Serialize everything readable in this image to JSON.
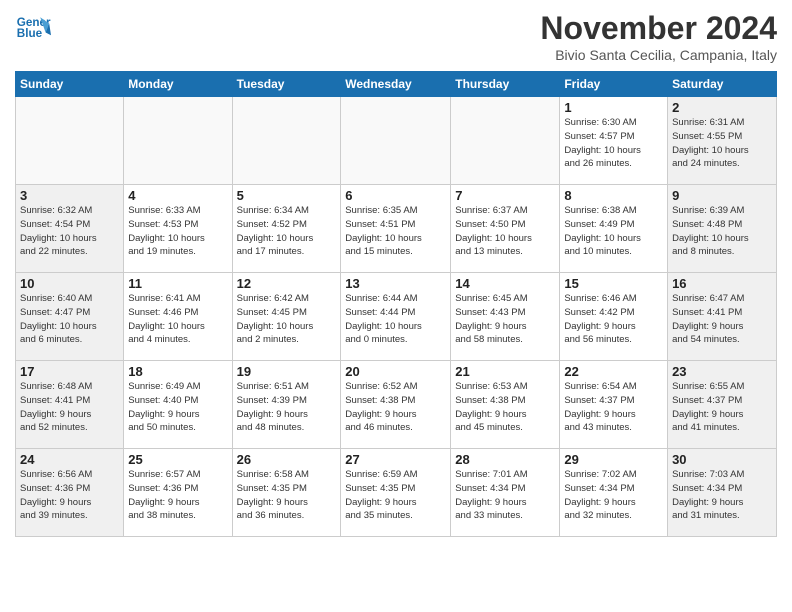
{
  "header": {
    "logo_line1": "General",
    "logo_line2": "Blue",
    "month_title": "November 2024",
    "location": "Bivio Santa Cecilia, Campania, Italy"
  },
  "weekdays": [
    "Sunday",
    "Monday",
    "Tuesday",
    "Wednesday",
    "Thursday",
    "Friday",
    "Saturday"
  ],
  "weeks": [
    [
      {
        "day": "",
        "info": ""
      },
      {
        "day": "",
        "info": ""
      },
      {
        "day": "",
        "info": ""
      },
      {
        "day": "",
        "info": ""
      },
      {
        "day": "",
        "info": ""
      },
      {
        "day": "1",
        "info": "Sunrise: 6:30 AM\nSunset: 4:57 PM\nDaylight: 10 hours\nand 26 minutes."
      },
      {
        "day": "2",
        "info": "Sunrise: 6:31 AM\nSunset: 4:55 PM\nDaylight: 10 hours\nand 24 minutes."
      }
    ],
    [
      {
        "day": "3",
        "info": "Sunrise: 6:32 AM\nSunset: 4:54 PM\nDaylight: 10 hours\nand 22 minutes."
      },
      {
        "day": "4",
        "info": "Sunrise: 6:33 AM\nSunset: 4:53 PM\nDaylight: 10 hours\nand 19 minutes."
      },
      {
        "day": "5",
        "info": "Sunrise: 6:34 AM\nSunset: 4:52 PM\nDaylight: 10 hours\nand 17 minutes."
      },
      {
        "day": "6",
        "info": "Sunrise: 6:35 AM\nSunset: 4:51 PM\nDaylight: 10 hours\nand 15 minutes."
      },
      {
        "day": "7",
        "info": "Sunrise: 6:37 AM\nSunset: 4:50 PM\nDaylight: 10 hours\nand 13 minutes."
      },
      {
        "day": "8",
        "info": "Sunrise: 6:38 AM\nSunset: 4:49 PM\nDaylight: 10 hours\nand 10 minutes."
      },
      {
        "day": "9",
        "info": "Sunrise: 6:39 AM\nSunset: 4:48 PM\nDaylight: 10 hours\nand 8 minutes."
      }
    ],
    [
      {
        "day": "10",
        "info": "Sunrise: 6:40 AM\nSunset: 4:47 PM\nDaylight: 10 hours\nand 6 minutes."
      },
      {
        "day": "11",
        "info": "Sunrise: 6:41 AM\nSunset: 4:46 PM\nDaylight: 10 hours\nand 4 minutes."
      },
      {
        "day": "12",
        "info": "Sunrise: 6:42 AM\nSunset: 4:45 PM\nDaylight: 10 hours\nand 2 minutes."
      },
      {
        "day": "13",
        "info": "Sunrise: 6:44 AM\nSunset: 4:44 PM\nDaylight: 10 hours\nand 0 minutes."
      },
      {
        "day": "14",
        "info": "Sunrise: 6:45 AM\nSunset: 4:43 PM\nDaylight: 9 hours\nand 58 minutes."
      },
      {
        "day": "15",
        "info": "Sunrise: 6:46 AM\nSunset: 4:42 PM\nDaylight: 9 hours\nand 56 minutes."
      },
      {
        "day": "16",
        "info": "Sunrise: 6:47 AM\nSunset: 4:41 PM\nDaylight: 9 hours\nand 54 minutes."
      }
    ],
    [
      {
        "day": "17",
        "info": "Sunrise: 6:48 AM\nSunset: 4:41 PM\nDaylight: 9 hours\nand 52 minutes."
      },
      {
        "day": "18",
        "info": "Sunrise: 6:49 AM\nSunset: 4:40 PM\nDaylight: 9 hours\nand 50 minutes."
      },
      {
        "day": "19",
        "info": "Sunrise: 6:51 AM\nSunset: 4:39 PM\nDaylight: 9 hours\nand 48 minutes."
      },
      {
        "day": "20",
        "info": "Sunrise: 6:52 AM\nSunset: 4:38 PM\nDaylight: 9 hours\nand 46 minutes."
      },
      {
        "day": "21",
        "info": "Sunrise: 6:53 AM\nSunset: 4:38 PM\nDaylight: 9 hours\nand 45 minutes."
      },
      {
        "day": "22",
        "info": "Sunrise: 6:54 AM\nSunset: 4:37 PM\nDaylight: 9 hours\nand 43 minutes."
      },
      {
        "day": "23",
        "info": "Sunrise: 6:55 AM\nSunset: 4:37 PM\nDaylight: 9 hours\nand 41 minutes."
      }
    ],
    [
      {
        "day": "24",
        "info": "Sunrise: 6:56 AM\nSunset: 4:36 PM\nDaylight: 9 hours\nand 39 minutes."
      },
      {
        "day": "25",
        "info": "Sunrise: 6:57 AM\nSunset: 4:36 PM\nDaylight: 9 hours\nand 38 minutes."
      },
      {
        "day": "26",
        "info": "Sunrise: 6:58 AM\nSunset: 4:35 PM\nDaylight: 9 hours\nand 36 minutes."
      },
      {
        "day": "27",
        "info": "Sunrise: 6:59 AM\nSunset: 4:35 PM\nDaylight: 9 hours\nand 35 minutes."
      },
      {
        "day": "28",
        "info": "Sunrise: 7:01 AM\nSunset: 4:34 PM\nDaylight: 9 hours\nand 33 minutes."
      },
      {
        "day": "29",
        "info": "Sunrise: 7:02 AM\nSunset: 4:34 PM\nDaylight: 9 hours\nand 32 minutes."
      },
      {
        "day": "30",
        "info": "Sunrise: 7:03 AM\nSunset: 4:34 PM\nDaylight: 9 hours\nand 31 minutes."
      }
    ]
  ]
}
